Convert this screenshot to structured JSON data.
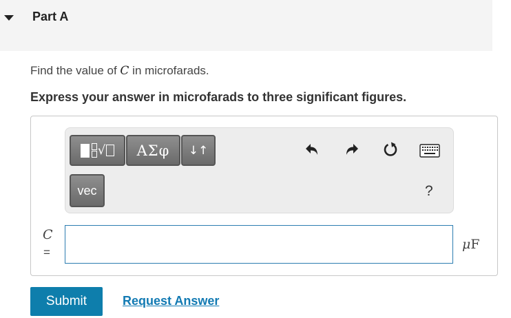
{
  "part": {
    "title": "Part A"
  },
  "question": {
    "prefix": "Find the value of ",
    "variable": "C",
    "suffix": " in microfarads."
  },
  "instruction": "Express your answer in microfarads to three significant figures.",
  "toolbar": {
    "greek_label": "ΑΣφ",
    "arrows_label": "↓↑",
    "vec_label": "vec",
    "help_label": "?",
    "icons": [
      "templates-icon",
      "undo-icon",
      "redo-icon",
      "reset-icon",
      "keyboard-icon"
    ]
  },
  "answer": {
    "variable": "C",
    "equals": "=",
    "value": "",
    "unit_prefix": "μ",
    "unit": "F"
  },
  "actions": {
    "submit_label": "Submit",
    "request_label": "Request Answer"
  },
  "colors": {
    "accent": "#0e7eac",
    "link": "#127ab3",
    "input_border": "#2b7cb0",
    "header_bg": "#f4f4f4"
  }
}
